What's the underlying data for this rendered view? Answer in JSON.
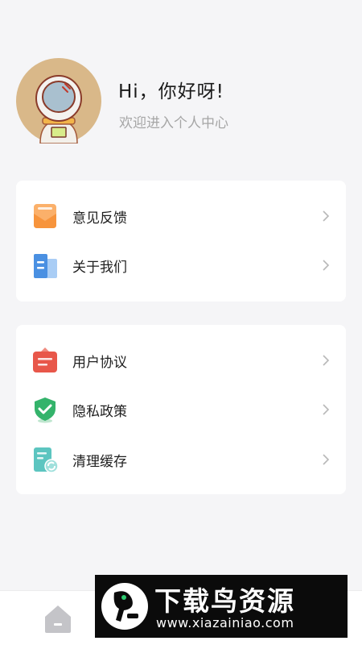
{
  "profile": {
    "greeting": "Hi，你好呀!",
    "subtitle": "欢迎进入个人中心"
  },
  "menu_group_1": [
    {
      "label": "意见反馈",
      "icon": "feedback-envelope-icon",
      "color": "#f7943c"
    },
    {
      "label": "关于我们",
      "icon": "building-icon",
      "color": "#4a90e2"
    }
  ],
  "menu_group_2": [
    {
      "label": "用户协议",
      "icon": "agreement-badge-icon",
      "color": "#e8574a"
    },
    {
      "label": "隐私政策",
      "icon": "shield-check-icon",
      "color": "#34b36b"
    },
    {
      "label": "清理缓存",
      "icon": "clean-cache-icon",
      "color": "#5cc5c0"
    }
  ],
  "watermark": {
    "title": "下载鸟资源",
    "url": "www.xiazainiao.com"
  },
  "colors": {
    "background": "#f5f5f7",
    "card": "#ffffff",
    "avatar_bg": "#d9b889"
  }
}
